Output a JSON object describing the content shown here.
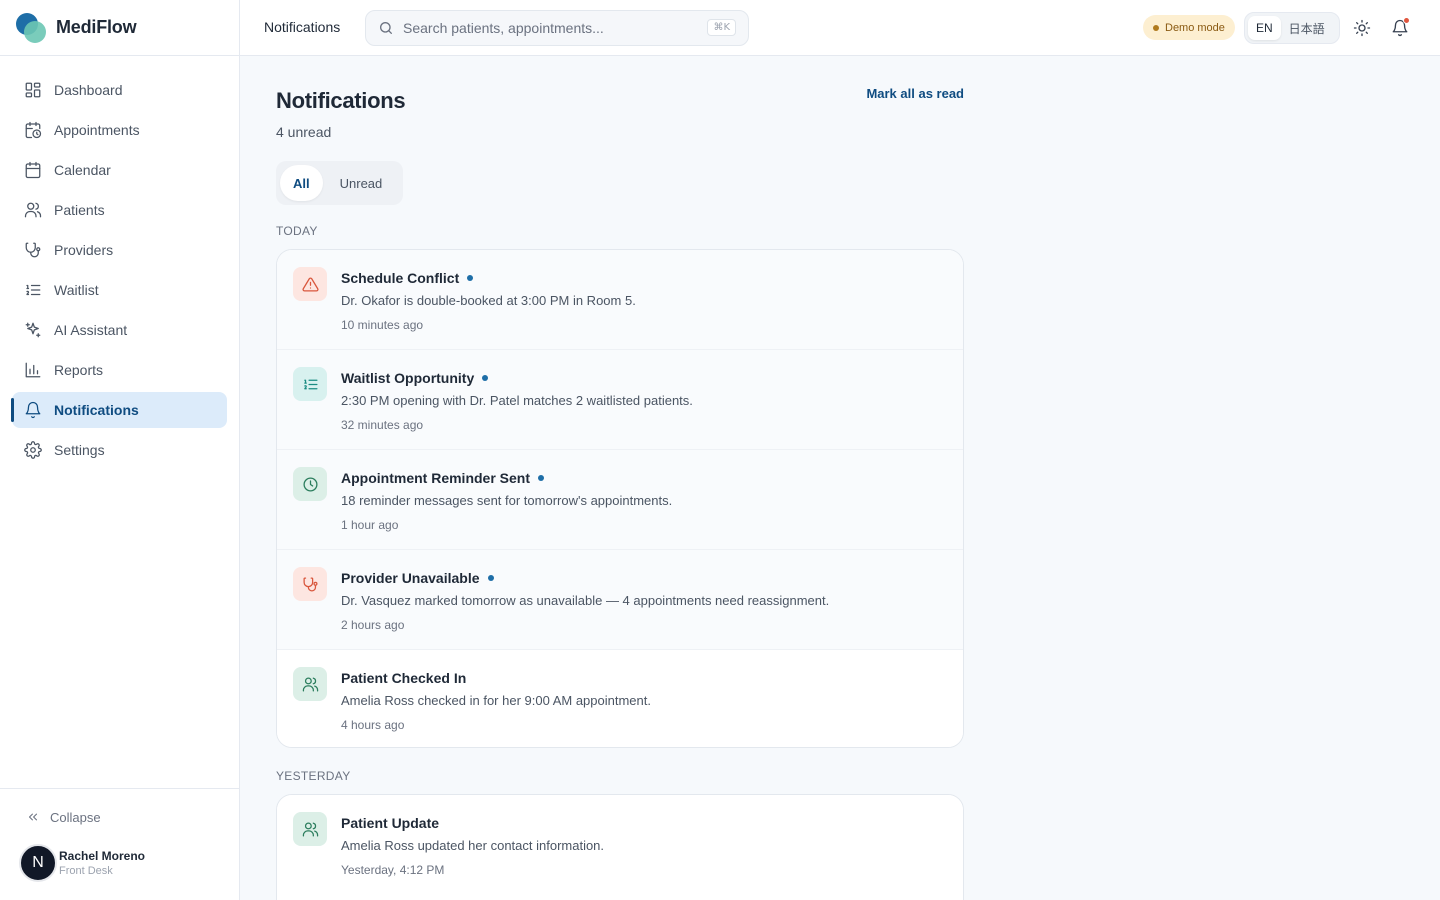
{
  "app": {
    "name": "MediFlow"
  },
  "sidebar": {
    "items": [
      {
        "label": "Dashboard",
        "icon": "grid-icon"
      },
      {
        "label": "Appointments",
        "icon": "calendar-clock-icon"
      },
      {
        "label": "Calendar",
        "icon": "calendar-icon"
      },
      {
        "label": "Patients",
        "icon": "users-icon"
      },
      {
        "label": "Providers",
        "icon": "stethoscope-icon"
      },
      {
        "label": "Waitlist",
        "icon": "list-ordered-icon"
      },
      {
        "label": "AI Assistant",
        "icon": "sparkles-icon"
      },
      {
        "label": "Reports",
        "icon": "bar-chart-icon"
      },
      {
        "label": "Notifications",
        "icon": "bell-icon",
        "active": true
      },
      {
        "label": "Settings",
        "icon": "gear-icon"
      }
    ],
    "collapse_label": "Collapse",
    "user": {
      "initial": "N",
      "name": "Rachel Moreno",
      "role": "Front Desk"
    }
  },
  "topbar": {
    "title": "Notifications",
    "search_placeholder": "Search patients, appointments...",
    "search_shortcut": "⌘K",
    "demo_label": "Demo mode",
    "languages": [
      "EN",
      "日本語"
    ],
    "active_language": "EN"
  },
  "page": {
    "title": "Notifications",
    "unread_count": "4 unread",
    "mark_all_label": "Mark all as read",
    "tabs": [
      "All",
      "Unread"
    ],
    "active_tab": "All"
  },
  "sections": [
    {
      "label": "TODAY",
      "items": [
        {
          "title": "Schedule Conflict",
          "body": "Dr. Okafor is double-booked at 3:00 PM in Room 5.",
          "time": "10 minutes ago",
          "unread": true,
          "icon": "warning-triangle-icon",
          "tone": "red"
        },
        {
          "title": "Waitlist Opportunity",
          "body": "2:30 PM opening with Dr. Patel matches 2 waitlisted patients.",
          "time": "32 minutes ago",
          "unread": true,
          "icon": "list-ordered-icon",
          "tone": "teal"
        },
        {
          "title": "Appointment Reminder Sent",
          "body": "18 reminder messages sent for tomorrow's appointments.",
          "time": "1 hour ago",
          "unread": true,
          "icon": "clock-icon",
          "tone": "green"
        },
        {
          "title": "Provider Unavailable",
          "body": "Dr. Vasquez marked tomorrow as unavailable — 4 appointments need reassignment.",
          "time": "2 hours ago",
          "unread": true,
          "icon": "stethoscope-icon",
          "tone": "red"
        },
        {
          "title": "Patient Checked In",
          "body": "Amelia Ross checked in for her 9:00 AM appointment.",
          "time": "4 hours ago",
          "unread": false,
          "icon": "users-icon",
          "tone": "green"
        }
      ]
    },
    {
      "label": "YESTERDAY",
      "items": [
        {
          "title": "Patient Update",
          "body": "Amelia Ross updated her contact information.",
          "time": "Yesterday, 4:12 PM",
          "unread": false,
          "icon": "users-icon",
          "tone": "green"
        }
      ]
    }
  ],
  "colors": {
    "accent": "#0f4c81",
    "active_nav_bg": "#dcebfa",
    "demo_badge_bg": "#fdefd1",
    "alert_red": "#d9573d",
    "teal": "#1a8c82",
    "green": "#2b7d5d"
  }
}
